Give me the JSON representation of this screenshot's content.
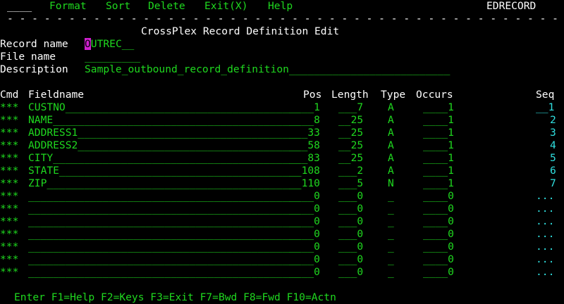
{
  "command_line": "____",
  "menu": [
    "Format",
    "Sort",
    "Delete",
    "Exit(X)",
    "Help"
  ],
  "screen_id": "EDRECORD",
  "separator": "- - - - - - - - - - - - - - - - - - - - - - - - - - - - - - - - - - - - - - - - - - - - - - - - - - - - - - - - - - - - - - - - - - - - - - - - - - - - - - - - - - - - - - - - - - - - - - - -",
  "title": "CrossPlex Record Definition Edit",
  "record_name": {
    "label": "Record name",
    "cursor_char": "O",
    "value": "UTREC__"
  },
  "file_name": {
    "label": "File name",
    "value": "_________"
  },
  "description": {
    "label": "Description",
    "value": "Sample_outbound_record_definition__________________________"
  },
  "headers": {
    "cmd": "Cmd",
    "fieldname": "Fieldname",
    "pos": "Pos",
    "length": "Length",
    "type": "Type",
    "occurs": "Occurs",
    "seq": "Seq"
  },
  "rows": [
    {
      "cmd": "***",
      "fieldname": "CUSTNO______________________________________",
      "pos": "____1",
      "length": "___7",
      "type": "A",
      "occurs": "____1",
      "seq": "__1"
    },
    {
      "cmd": "***",
      "fieldname": "NAME________________________________________",
      "pos": "____8",
      "length": "__25",
      "type": "A",
      "occurs": "____1",
      "seq": "2"
    },
    {
      "cmd": "***",
      "fieldname": "ADDRESS1____________________________________",
      "pos": "___33",
      "length": "__25",
      "type": "A",
      "occurs": "____1",
      "seq": "3"
    },
    {
      "cmd": "***",
      "fieldname": "ADDRESS2____________________________________",
      "pos": "___58",
      "length": "__25",
      "type": "A",
      "occurs": "____1",
      "seq": "4"
    },
    {
      "cmd": "***",
      "fieldname": "CITY________________________________________",
      "pos": "___83",
      "length": "__25",
      "type": "A",
      "occurs": "____1",
      "seq": "5"
    },
    {
      "cmd": "***",
      "fieldname": "STATE_______________________________________",
      "pos": "__108",
      "length": "___2",
      "type": "A",
      "occurs": "____1",
      "seq": "6"
    },
    {
      "cmd": "***",
      "fieldname": "ZIP_________________________________________",
      "pos": "__110",
      "length": "___5",
      "type": "N",
      "occurs": "____1",
      "seq": "7"
    },
    {
      "cmd": "***",
      "fieldname": "____________________________________________",
      "pos": "____0",
      "length": "___0",
      "type": "_",
      "occurs": "____0",
      "seq": "..."
    },
    {
      "cmd": "***",
      "fieldname": "____________________________________________",
      "pos": "____0",
      "length": "___0",
      "type": "_",
      "occurs": "____0",
      "seq": "..."
    },
    {
      "cmd": "***",
      "fieldname": "____________________________________________",
      "pos": "____0",
      "length": "___0",
      "type": "_",
      "occurs": "____0",
      "seq": "..."
    },
    {
      "cmd": "***",
      "fieldname": "____________________________________________",
      "pos": "____0",
      "length": "___0",
      "type": "_",
      "occurs": "____0",
      "seq": "..."
    },
    {
      "cmd": "***",
      "fieldname": "____________________________________________",
      "pos": "____0",
      "length": "___0",
      "type": "_",
      "occurs": "____0",
      "seq": "..."
    },
    {
      "cmd": "***",
      "fieldname": "____________________________________________",
      "pos": "____0",
      "length": "___0",
      "type": "_",
      "occurs": "____0",
      "seq": "..."
    },
    {
      "cmd": "***",
      "fieldname": "____________________________________________",
      "pos": "____0",
      "length": "___0",
      "type": "_",
      "occurs": "____0",
      "seq": "..."
    }
  ],
  "function_keys": "Enter F1=Help F2=Keys F3=Exit F7=Bwd F8=Fwd F10=Actn",
  "colors": {
    "background": "#000000",
    "green": "#1fd81f",
    "white": "#ffffff",
    "cyan": "#30e0e0",
    "cursor": "#d020d0"
  }
}
